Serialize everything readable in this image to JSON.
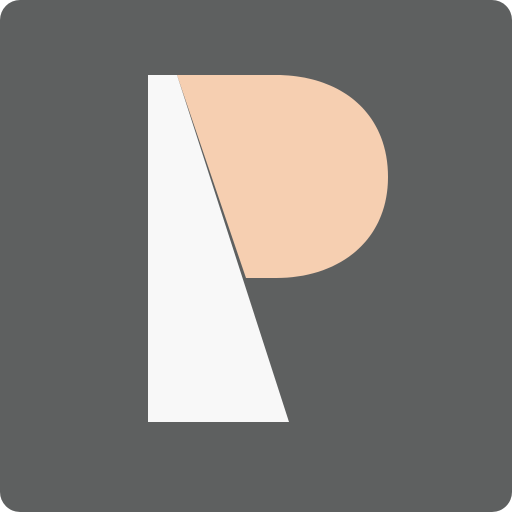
{
  "icon": {
    "name": "app-logo-p-icon",
    "colors": {
      "tile": "#5e6060",
      "bowl": "#f6cfb1",
      "stem": "#f8f8f8"
    }
  }
}
